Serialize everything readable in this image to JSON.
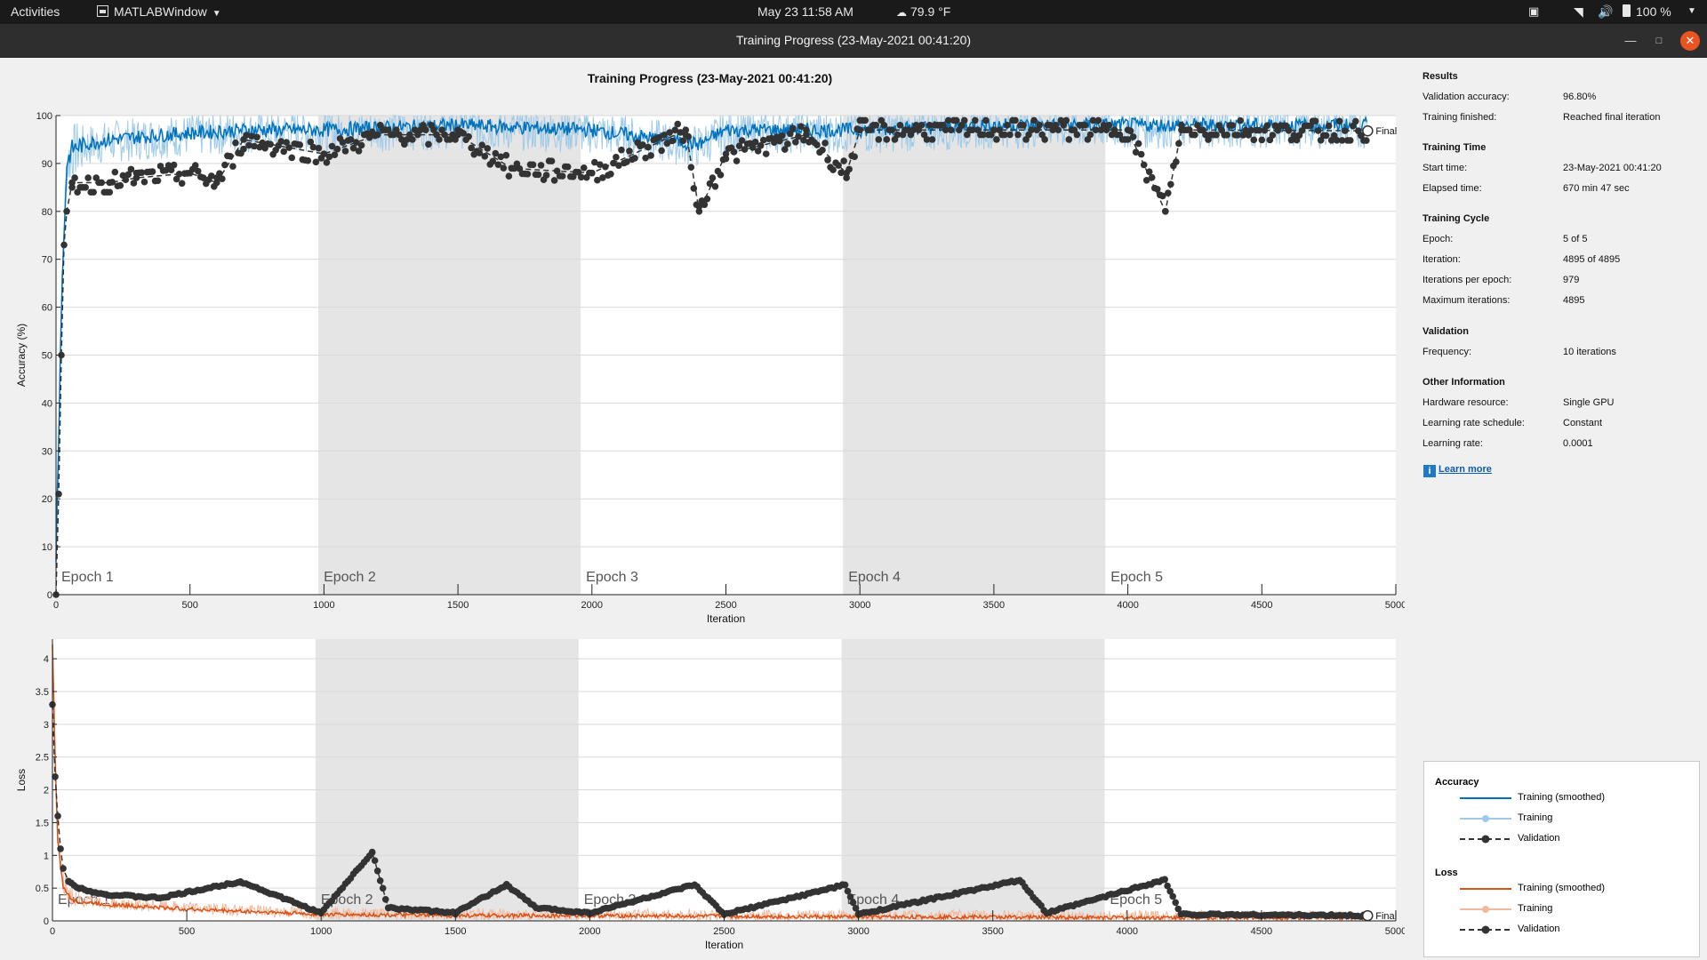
{
  "topbar": {
    "activities": "Activities",
    "app_menu": "MATLABWindow",
    "datetime": "May 23  11:58 AM",
    "weather": "79.9 °F",
    "battery": "100 %"
  },
  "window": {
    "title": "Training Progress (23-May-2021 00:41:20)"
  },
  "figure": {
    "title": "Training Progress (23-May-2021 00:41:20)"
  },
  "info": {
    "results_head": "Results",
    "val_acc_label": "Validation accuracy:",
    "val_acc": "96.80%",
    "finished_label": "Training finished:",
    "finished": "Reached final iteration",
    "time_head": "Training Time",
    "start_label": "Start time:",
    "start": "23-May-2021 00:41:20",
    "elapsed_label": "Elapsed time:",
    "elapsed": "670 min 47 sec",
    "cycle_head": "Training Cycle",
    "epoch_label": "Epoch:",
    "epoch": "5 of 5",
    "iter_label": "Iteration:",
    "iter": "4895 of 4895",
    "ipe_label": "Iterations per epoch:",
    "ipe": "979",
    "maxit_label": "Maximum iterations:",
    "maxit": "4895",
    "valid_head": "Validation",
    "freq_label": "Frequency:",
    "freq": "10 iterations",
    "other_head": "Other Information",
    "hw_label": "Hardware resource:",
    "hw": "Single GPU",
    "lrs_label": "Learning rate schedule:",
    "lrs": "Constant",
    "lr_label": "Learning rate:",
    "lr": "0.0001",
    "learn_more": "Learn more"
  },
  "legend": {
    "acc_head": "Accuracy",
    "loss_head": "Loss",
    "smoothed": "Training (smoothed)",
    "training": "Training",
    "validation": "Validation"
  },
  "chart_data": [
    {
      "type": "line",
      "ylabel": "Accuracy (%)",
      "xlabel": "Iteration",
      "xlim": [
        0,
        5000
      ],
      "ylim": [
        0,
        100
      ],
      "xticks": [
        0,
        500,
        1000,
        1500,
        2000,
        2500,
        3000,
        3500,
        4000,
        4500,
        5000
      ],
      "yticks": [
        0,
        10,
        20,
        30,
        40,
        50,
        60,
        70,
        80,
        90,
        100
      ],
      "epoch_labels": [
        "Epoch 1",
        "Epoch 2",
        "Epoch 3",
        "Epoch 4",
        "Epoch 5"
      ],
      "epoch_boundaries": [
        0,
        979,
        1958,
        2937,
        3916,
        4895
      ],
      "final_label": "Final",
      "series": [
        {
          "name": "Training (smoothed)",
          "x": [
            0,
            20,
            40,
            60,
            100,
            200,
            400,
            700,
            1000,
            1500,
            2000,
            2400,
            2500,
            3000,
            3500,
            4000,
            4500,
            4895
          ],
          "values": [
            8,
            60,
            90,
            93,
            94,
            95,
            96,
            97,
            97,
            98,
            97,
            94,
            97,
            97,
            98,
            98,
            98,
            98
          ]
        },
        {
          "name": "Validation",
          "x": [
            0,
            10,
            20,
            30,
            40,
            60,
            200,
            300,
            500,
            600,
            700,
            1000,
            1200,
            1500,
            1700,
            2000,
            2350,
            2400,
            2500,
            2800,
            2950,
            3000,
            3500,
            4000,
            4140,
            4200,
            4895
          ],
          "values": [
            0,
            21,
            50,
            73,
            80,
            86,
            86,
            87,
            88,
            86,
            95,
            92,
            96,
            96,
            89,
            88,
            97,
            80,
            92,
            96,
            88,
            97,
            97,
            97,
            80,
            97,
            96.8
          ]
        }
      ]
    },
    {
      "type": "line",
      "ylabel": "Loss",
      "xlabel": "Iteration",
      "xlim": [
        0,
        5000
      ],
      "ylim": [
        0,
        4.3
      ],
      "xticks": [
        0,
        500,
        1000,
        1500,
        2000,
        2500,
        3000,
        3500,
        4000,
        4500,
        5000
      ],
      "yticks": [
        0,
        0.5,
        1,
        1.5,
        2,
        2.5,
        3,
        3.5,
        4
      ],
      "epoch_labels": [
        "Epoch 1",
        "Epoch 2",
        "Epoch 3",
        "Epoch 4",
        "Epoch 5"
      ],
      "epoch_boundaries": [
        0,
        979,
        1958,
        2937,
        3916,
        4895
      ],
      "final_label": "Final",
      "series": [
        {
          "name": "Training (smoothed)",
          "x": [
            0,
            10,
            20,
            40,
            80,
            200,
            500,
            1000,
            1500,
            2000,
            2500,
            3000,
            3500,
            4000,
            4500,
            4895
          ],
          "values": [
            4.2,
            2.5,
            1.2,
            0.5,
            0.3,
            0.25,
            0.18,
            0.1,
            0.08,
            0.08,
            0.07,
            0.06,
            0.06,
            0.05,
            0.05,
            0.05
          ]
        },
        {
          "name": "Validation",
          "x": [
            0,
            10,
            20,
            30,
            40,
            60,
            100,
            200,
            400,
            700,
            1000,
            1190,
            1250,
            1500,
            1690,
            1800,
            2000,
            2390,
            2500,
            2950,
            3000,
            3600,
            3700,
            4140,
            4200,
            4895
          ],
          "values": [
            3.3,
            2.2,
            1.6,
            1.1,
            0.8,
            0.6,
            0.5,
            0.4,
            0.35,
            0.6,
            0.12,
            1.05,
            0.2,
            0.12,
            0.55,
            0.2,
            0.12,
            0.55,
            0.1,
            0.55,
            0.1,
            0.62,
            0.12,
            0.63,
            0.1,
            0.08
          ]
        }
      ]
    }
  ]
}
